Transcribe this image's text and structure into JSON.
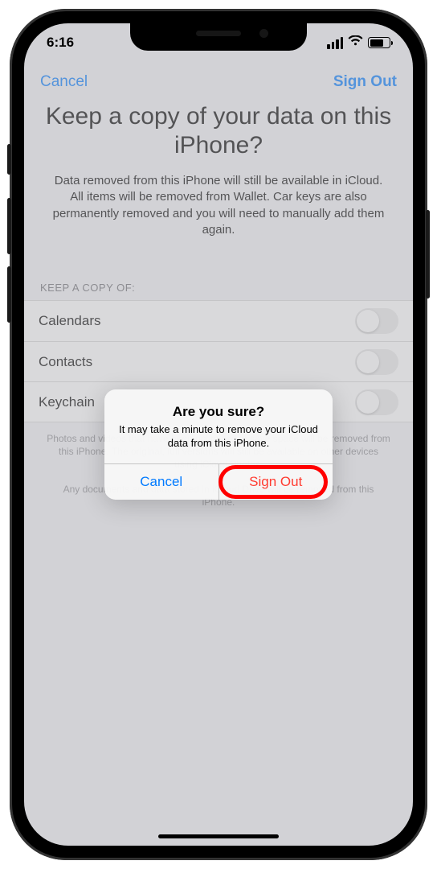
{
  "status": {
    "time": "6:16"
  },
  "nav": {
    "left": "Cancel",
    "right": "Sign Out"
  },
  "page": {
    "title": "Keep a copy of your data on this iPhone?",
    "description": "Data removed from this iPhone will still be available in iCloud. All items will be removed from Wallet. Car keys are also permanently removed and you will need to manually add them again.",
    "section_header": "KEEP A COPY OF:",
    "items": [
      {
        "label": "Calendars"
      },
      {
        "label": "Contacts"
      },
      {
        "label": "Keychain"
      }
    ],
    "footer1": "Photos and videos that have been optimized to save space will be removed from this iPhone. The original, full versions will still be available on other devices using iCloud Photos.",
    "footer2": "Any documents and data stored in iCloud Drive will be removed from this iPhone."
  },
  "alert": {
    "title": "Are you sure?",
    "message": "It may take a minute to remove your iCloud data from this iPhone.",
    "cancel": "Cancel",
    "confirm": "Sign Out"
  }
}
